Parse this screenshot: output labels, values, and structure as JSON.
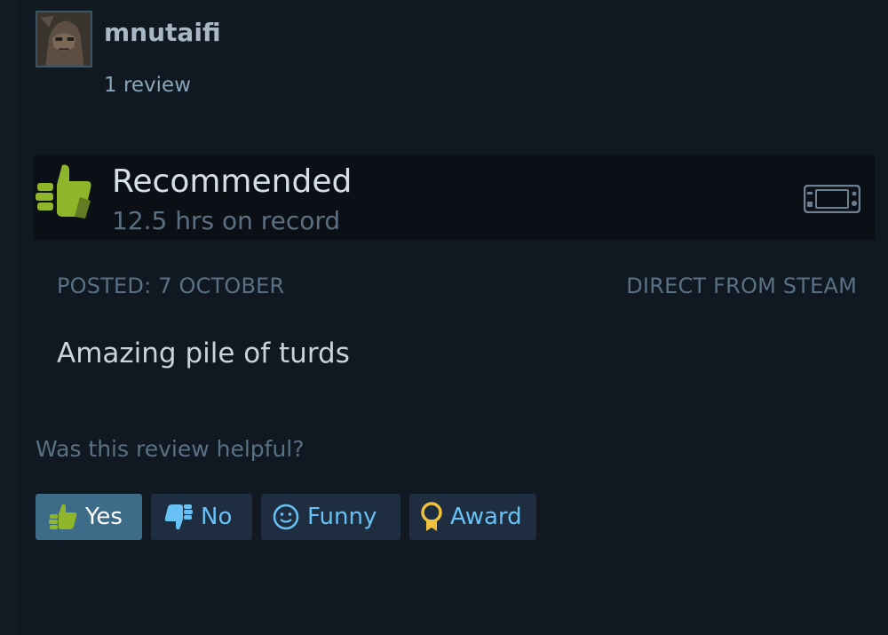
{
  "author": {
    "name": "mnutaifi",
    "review_count": "1 review"
  },
  "recommendation": {
    "status": "Recommended",
    "hours": "12.5 hrs on record",
    "icon": "thumbs-up-icon",
    "platform_icon": "steam-deck-icon"
  },
  "meta": {
    "posted": "POSTED: 7 OCTOBER",
    "source": "DIRECT FROM STEAM"
  },
  "review": {
    "text": "Amazing pile of turds"
  },
  "feedback": {
    "question": "Was this review helpful?",
    "yes_label": "Yes",
    "no_label": "No",
    "funny_label": "Funny",
    "award_label": "Award"
  },
  "colors": {
    "background": "#0f141c",
    "thumb_green": "#8fb62a",
    "link_blue": "#67c1f5",
    "yes_active": "#3d6c88",
    "award_gold": "#f0c13a"
  }
}
